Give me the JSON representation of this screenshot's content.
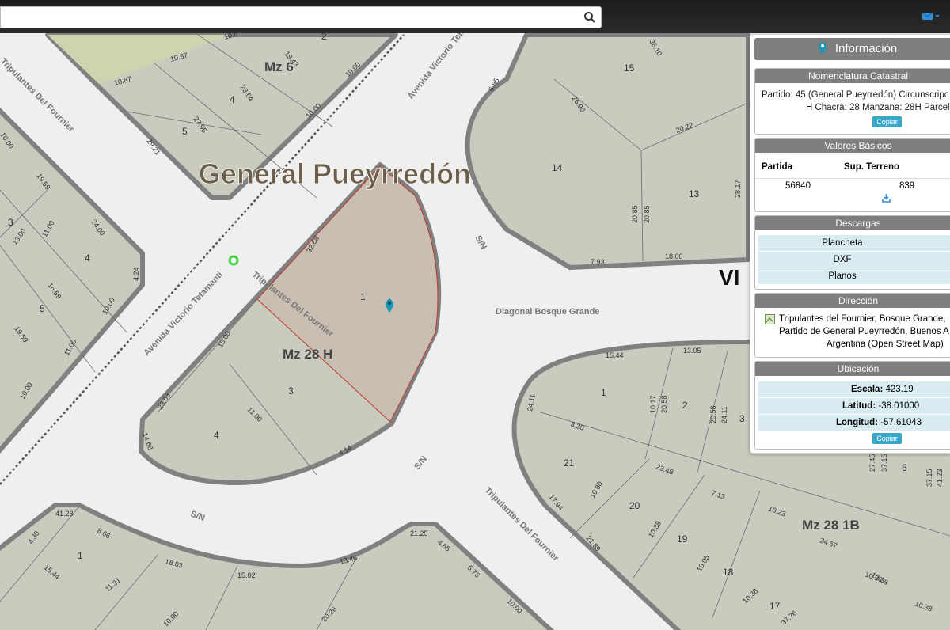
{
  "search": {
    "placeholder": ""
  },
  "map": {
    "city_label": "General Pueyrredón",
    "partial_label": "VI",
    "blocks": [
      "Mz 6",
      "Mz 28 H",
      "Mz 28 1B"
    ],
    "streets": [
      "Avenida Victorio Tetamanti",
      "Avenida Victorio Tetamanti",
      "Tripulantes Del Fournier",
      "Tripulantes Del Fournier",
      "Diagonal Bosque Grande",
      "S/N",
      "S/N",
      "S/N",
      "Tripulantes Del Fournier"
    ],
    "parcel_numbers": [
      "2",
      "4",
      "5",
      "15",
      "14",
      "13",
      "3",
      "4",
      "5",
      "1",
      "3",
      "4",
      "1",
      "2",
      "3",
      "21",
      "20",
      "19",
      "18",
      "17",
      "6",
      "1"
    ],
    "measures": [
      "10.87",
      "10.87",
      "10.8",
      "19.43",
      "23.64",
      "10.00",
      "10.00",
      "27.95",
      "29.21",
      "36.10",
      "6.85",
      "26.90",
      "20.22",
      "20.85",
      "20.85",
      "28.17",
      "7.93",
      "18.00",
      "32.68",
      "15.00",
      "4.24",
      "10.00",
      "11.00",
      "11.00",
      "13.00",
      "24.00",
      "16.59",
      "19.59",
      "19.59",
      "10.00",
      "10.00",
      "11.00",
      "29.03",
      "14.68",
      "4.14",
      "15.44",
      "13.05",
      "10.17",
      "20.58",
      "20.58",
      "24.11",
      "24.11",
      "3.20",
      "23.48",
      "10.80",
      "17.94",
      "7.13",
      "10.38",
      "21.89",
      "10.05",
      "24.67",
      "10.38",
      "10.38",
      "27.45",
      "37.15",
      "37.15",
      "41.23",
      "41.23",
      "4.30",
      "8.66",
      "15.44",
      "18.03",
      "11.31",
      "15.02",
      "13.46",
      "21.25",
      "4.65",
      "5.78",
      "10.00",
      "10.00",
      "20.26",
      "37.76",
      "10.23",
      "10.38",
      "10.38",
      "10.0"
    ]
  },
  "panel": {
    "title": "Información",
    "nomenclatura": {
      "header": "Nomenclatura Catastral",
      "line1": "Partido: 45 (General Pueyrredón) Circunscripc",
      "line2": "H Chacra: 28 Manzana: 28H Parcel",
      "copy": "Copiar"
    },
    "valores": {
      "header": "Valores Básicos",
      "col1": "Partida",
      "col2": "Sup. Terreno",
      "val1": "56840",
      "val2": "839"
    },
    "descargas": {
      "header": "Descargas",
      "items": [
        "Plancheta",
        "DXF",
        "Planos"
      ]
    },
    "direccion": {
      "header": "Dirección",
      "line1": "Tripulantes del Fournier, Bosque Grande,",
      "line2": "Partido de General Pueyrredón, Buenos A",
      "line3": "Argentina (Open Street Map)"
    },
    "ubicacion": {
      "header": "Ubicación",
      "escala_label": "Escala:",
      "escala": "423.19",
      "lat_label": "Latitud:",
      "lat": "-38.01000",
      "lon_label": "Longitud:",
      "lon": "-57.61043",
      "copy": "Copiar"
    }
  },
  "colors": {
    "block_fill": "#c8cbbe",
    "block_border": "#808080",
    "selected_parcel": "#c8bfb2",
    "park": "#cfd3b0",
    "marker": "#1996b8",
    "header_grey": "#7e7e7e",
    "row_blue": "#d8ecf1"
  }
}
